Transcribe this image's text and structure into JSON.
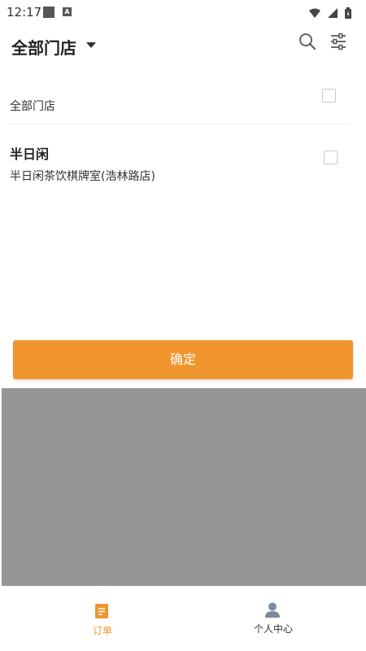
{
  "status_bar": {
    "time": "12:17"
  },
  "header": {
    "title": "全部门店"
  },
  "store_list": {
    "all_stores_label": "全部门店",
    "stores": [
      {
        "name": "半日闲",
        "branch": "半日闲茶饮棋牌室(浩林路店)"
      }
    ]
  },
  "confirm_label": "确定",
  "bottom_nav": {
    "items": [
      {
        "label": "订单",
        "icon": "orders-icon",
        "active": true
      },
      {
        "label": "个人中心",
        "icon": "person-icon",
        "active": false
      }
    ]
  },
  "colors": {
    "accent": "#f0952d",
    "overlay": "#959595"
  }
}
